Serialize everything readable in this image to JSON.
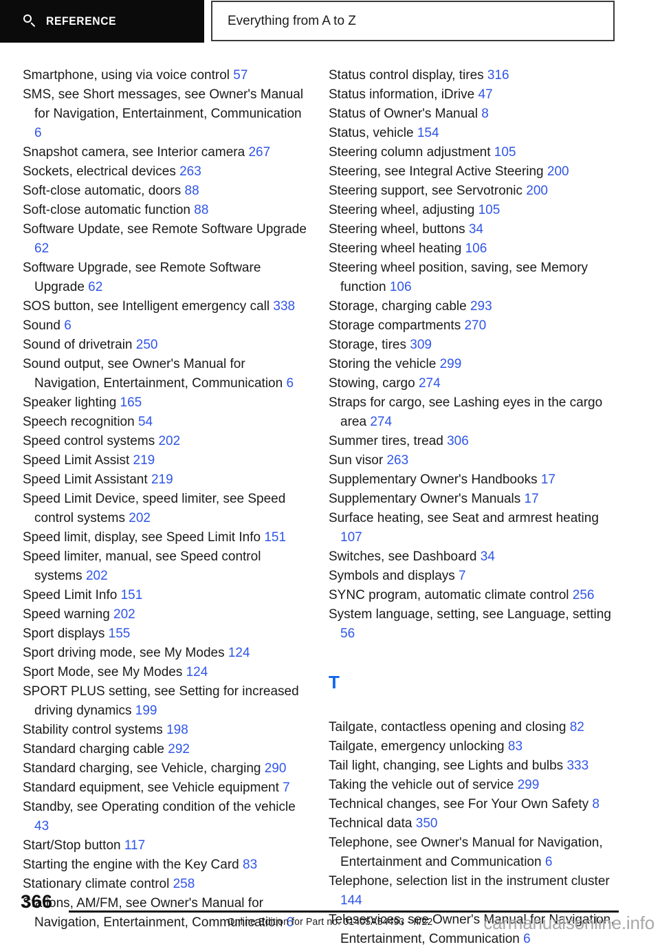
{
  "header": {
    "tab_label": "REFERENCE",
    "search_icon": "search-icon",
    "title": "Everything from A to Z"
  },
  "colors": {
    "link_blue": "#2f55e8",
    "heading_blue": "#1166ee",
    "tab_background": "#0b0b0b",
    "text": "#1a1a1a",
    "watermark_gray": "#a8a8a8"
  },
  "columns": {
    "left": [
      {
        "text": "Smartphone, using via voice control ",
        "page": "57"
      },
      {
        "text": "SMS, see Short messages, see Owner's Manual for Navigation, Entertainment, Communication ",
        "page": "6"
      },
      {
        "text": "Snapshot camera, see Interior camera ",
        "page": "267"
      },
      {
        "text": "Sockets, electrical devices ",
        "page": "263"
      },
      {
        "text": "Soft-close automatic, doors ",
        "page": "88"
      },
      {
        "text": "Soft-close automatic function ",
        "page": "88"
      },
      {
        "text": "Software Update, see Remote Software Upgrade ",
        "page": "62"
      },
      {
        "text": "Software Upgrade, see Remote Software Upgrade ",
        "page": "62"
      },
      {
        "text": "SOS button, see Intelligent emergency call ",
        "page": "338"
      },
      {
        "text": "Sound ",
        "page": "6"
      },
      {
        "text": "Sound of drivetrain ",
        "page": "250"
      },
      {
        "text": "Sound output, see Owner's Manual for Navigation, Entertainment, Communication ",
        "page": "6"
      },
      {
        "text": "Speaker lighting ",
        "page": "165"
      },
      {
        "text": "Speech recognition ",
        "page": "54"
      },
      {
        "text": "Speed control systems ",
        "page": "202"
      },
      {
        "text": "Speed Limit Assist ",
        "page": "219"
      },
      {
        "text": "Speed Limit Assistant ",
        "page": "219"
      },
      {
        "text": "Speed Limit Device, speed limiter, see Speed control systems ",
        "page": "202"
      },
      {
        "text": "Speed limit, display, see Speed Limit Info ",
        "page": "151"
      },
      {
        "text": "Speed limiter, manual, see Speed control systems ",
        "page": "202"
      },
      {
        "text": "Speed Limit Info ",
        "page": "151"
      },
      {
        "text": "Speed warning ",
        "page": "202"
      },
      {
        "text": "Sport displays ",
        "page": "155"
      },
      {
        "text": "Sport driving mode, see My Modes ",
        "page": "124"
      },
      {
        "text": "Sport Mode, see My Modes ",
        "page": "124"
      },
      {
        "text": "SPORT PLUS setting, see Setting for increased driving dynamics ",
        "page": "199"
      },
      {
        "text": "Stability control systems ",
        "page": "198"
      },
      {
        "text": "Standard charging cable ",
        "page": "292"
      },
      {
        "text": "Standard charging, see Vehicle, charging ",
        "page": "290"
      },
      {
        "text": "Standard equipment, see Vehicle equipment ",
        "page": "7"
      },
      {
        "text": "Standby, see Operating condition of the vehicle ",
        "page": "43"
      },
      {
        "text": "Start/Stop button ",
        "page": "117"
      },
      {
        "text": "Starting the engine with the Key Card ",
        "page": "83"
      },
      {
        "text": "Stationary climate control ",
        "page": "258"
      },
      {
        "text": "Stations, AM/FM, see Owner's Manual for Navigation, Entertainment, Communication ",
        "page": "6"
      }
    ],
    "right": [
      {
        "text": "Status control display, tires ",
        "page": "316"
      },
      {
        "text": "Status information, iDrive ",
        "page": "47"
      },
      {
        "text": "Status of Owner's Manual ",
        "page": "8"
      },
      {
        "text": "Status, vehicle ",
        "page": "154"
      },
      {
        "text": "Steering column adjustment ",
        "page": "105"
      },
      {
        "text": "Steering, see Integral Active Steering ",
        "page": "200"
      },
      {
        "text": "Steering support, see Servotronic ",
        "page": "200"
      },
      {
        "text": "Steering wheel, adjusting ",
        "page": "105"
      },
      {
        "text": "Steering wheel, buttons ",
        "page": "34"
      },
      {
        "text": "Steering wheel heating ",
        "page": "106"
      },
      {
        "text": "Steering wheel position, saving, see Memory function ",
        "page": "106"
      },
      {
        "text": "Storage, charging cable ",
        "page": "293"
      },
      {
        "text": "Storage compartments ",
        "page": "270"
      },
      {
        "text": "Storage, tires ",
        "page": "309"
      },
      {
        "text": "Storing the vehicle ",
        "page": "299"
      },
      {
        "text": "Stowing, cargo ",
        "page": "274"
      },
      {
        "text": "Straps for cargo, see Lashing eyes in the cargo area ",
        "page": "274"
      },
      {
        "text": "Summer tires, tread ",
        "page": "306"
      },
      {
        "text": "Sun visor ",
        "page": "263"
      },
      {
        "text": "Supplementary Owner's Handbooks ",
        "page": "17"
      },
      {
        "text": "Supplementary Owner's Manuals ",
        "page": "17"
      },
      {
        "text": "Surface heating, see Seat and armrest heating ",
        "page": "107"
      },
      {
        "text": "Switches, see Dashboard ",
        "page": "34"
      },
      {
        "text": "Symbols and displays ",
        "page": "7"
      },
      {
        "text": "SYNC program, automatic climate control ",
        "page": "256"
      },
      {
        "text": "System language, setting, see Language, setting ",
        "page": "56"
      }
    ],
    "right_section_heading": "T",
    "right_after_heading": [
      {
        "text": "Tailgate, contactless opening and closing ",
        "page": "82"
      },
      {
        "text": "Tailgate, emergency unlocking ",
        "page": "83"
      },
      {
        "text": "Tail light, changing, see Lights and bulbs ",
        "page": "333"
      },
      {
        "text": "Taking the vehicle out of service ",
        "page": "299"
      },
      {
        "text": "Technical changes, see For Your Own Safety ",
        "page": "8"
      },
      {
        "text": "Technical data ",
        "page": "350"
      },
      {
        "text": "Telephone, see Owner's Manual for Navigation, Entertainment and Communication ",
        "page": "6"
      },
      {
        "text": "Telephone, selection list in the instrument cluster ",
        "page": "144"
      },
      {
        "text": "Teleservices, see Owner's Manual for Navigation, Entertainment, Communication ",
        "page": "6"
      }
    ]
  },
  "footer": {
    "page_number": "366",
    "note": "Online Edition for Part no. 01405A54493 - II/22",
    "watermark": "carmanualsonline.info"
  }
}
